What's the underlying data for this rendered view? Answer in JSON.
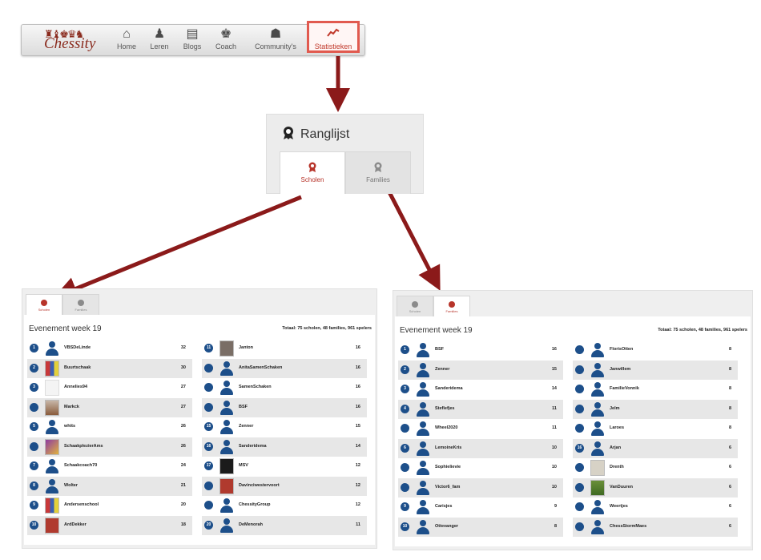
{
  "nav": {
    "logo_text": "Chessity",
    "items": [
      {
        "label": "Home",
        "icon": "home-icon"
      },
      {
        "label": "Leren",
        "icon": "pawn-icon"
      },
      {
        "label": "Blogs",
        "icon": "newspaper-icon"
      },
      {
        "label": "Coach",
        "icon": "coach-icon"
      },
      {
        "label": "Community's",
        "icon": "community-icon"
      },
      {
        "label": "Statistieken",
        "icon": "chart-line-icon"
      }
    ],
    "active_index": 5
  },
  "ranking": {
    "title": "Ranglijst",
    "tabs": [
      {
        "label": "Scholen",
        "icon": "award-icon"
      },
      {
        "label": "Families",
        "icon": "award-icon"
      }
    ]
  },
  "panel_scholen": {
    "tabs": [
      "Scholen",
      "Families"
    ],
    "active_tab": "Scholen",
    "title": "Evenement week 19",
    "total": "Totaal: 75 scholen, 48 families, 961 spelers",
    "left": [
      {
        "rank": "1",
        "name": "VBSDeLinde",
        "score": "32",
        "avatar": "generic"
      },
      {
        "rank": "2",
        "name": "Buurtschaak",
        "score": "30",
        "avatar": "multi"
      },
      {
        "rank": "3",
        "name": "Annelies94",
        "score": "27",
        "avatar": "pawn"
      },
      {
        "rank": "",
        "name": "Markck",
        "score": "27",
        "avatar": "kid"
      },
      {
        "rank": "5",
        "name": "whits",
        "score": "26",
        "avatar": "generic"
      },
      {
        "rank": "",
        "name": "SchaakplezierAms",
        "score": "26",
        "avatar": "tile"
      },
      {
        "rank": "7",
        "name": "Schaakcoach70",
        "score": "24",
        "avatar": "generic"
      },
      {
        "rank": "8",
        "name": "Wolter",
        "score": "21",
        "avatar": "generic"
      },
      {
        "rank": "9",
        "name": "Andersenschool",
        "score": "20",
        "avatar": "multi"
      },
      {
        "rank": "10",
        "name": "ArdDekker",
        "score": "18",
        "avatar": "red"
      }
    ],
    "right": [
      {
        "rank": "11",
        "name": "Janton",
        "score": "16",
        "avatar": "photo"
      },
      {
        "rank": "",
        "name": "AnitaSamenSchaken",
        "score": "16",
        "avatar": "generic"
      },
      {
        "rank": "",
        "name": "SamenSchaken",
        "score": "16",
        "avatar": "generic"
      },
      {
        "rank": "",
        "name": "BSF",
        "score": "16",
        "avatar": "generic"
      },
      {
        "rank": "15",
        "name": "Zenner",
        "score": "15",
        "avatar": "generic"
      },
      {
        "rank": "16",
        "name": "Sanderidema",
        "score": "14",
        "avatar": "generic"
      },
      {
        "rank": "17",
        "name": "MSV",
        "score": "12",
        "avatar": "chess"
      },
      {
        "rank": "",
        "name": "Davinciwestervoort",
        "score": "12",
        "avatar": "red"
      },
      {
        "rank": "",
        "name": "ChessityGroup",
        "score": "12",
        "avatar": "generic"
      },
      {
        "rank": "20",
        "name": "DeMenorah",
        "score": "11",
        "avatar": "generic"
      }
    ]
  },
  "panel_families": {
    "tabs": [
      "Scholen",
      "Families"
    ],
    "active_tab": "Families",
    "title": "Evenement week 19",
    "total": "Totaal: 75 scholen, 48 families, 961 spelers",
    "left": [
      {
        "rank": "1",
        "name": "BSF",
        "score": "16",
        "avatar": "generic"
      },
      {
        "rank": "2",
        "name": "Zenner",
        "score": "15",
        "avatar": "generic"
      },
      {
        "rank": "3",
        "name": "Sanderidema",
        "score": "14",
        "avatar": "generic"
      },
      {
        "rank": "4",
        "name": "Steflefjes",
        "score": "11",
        "avatar": "generic"
      },
      {
        "rank": "",
        "name": "Wheel2020",
        "score": "11",
        "avatar": "generic"
      },
      {
        "rank": "6",
        "name": "LemoineKris",
        "score": "10",
        "avatar": "generic"
      },
      {
        "rank": "",
        "name": "Sophielievie",
        "score": "10",
        "avatar": "generic"
      },
      {
        "rank": "",
        "name": "Victor6_fam",
        "score": "10",
        "avatar": "generic"
      },
      {
        "rank": "9",
        "name": "Carisjes",
        "score": "9",
        "avatar": "generic"
      },
      {
        "rank": "10",
        "name": "Ottevanger",
        "score": "8",
        "avatar": "generic"
      }
    ],
    "right": [
      {
        "rank": "",
        "name": "FlorisOtten",
        "score": "8",
        "avatar": "generic"
      },
      {
        "rank": "",
        "name": "Janwillem",
        "score": "8",
        "avatar": "generic"
      },
      {
        "rank": "",
        "name": "FamilieVonnik",
        "score": "8",
        "avatar": "generic"
      },
      {
        "rank": "",
        "name": "Jelm",
        "score": "8",
        "avatar": "generic"
      },
      {
        "rank": "",
        "name": "Laroes",
        "score": "8",
        "avatar": "generic"
      },
      {
        "rank": "16",
        "name": "Arjan",
        "score": "6",
        "avatar": "generic"
      },
      {
        "rank": "",
        "name": "Drenth",
        "score": "6",
        "avatar": "mole"
      },
      {
        "rank": "",
        "name": "VanDuuren",
        "score": "6",
        "avatar": "green"
      },
      {
        "rank": "",
        "name": "Weertjes",
        "score": "6",
        "avatar": "generic"
      },
      {
        "rank": "",
        "name": "ChessStormMaes",
        "score": "6",
        "avatar": "generic"
      }
    ]
  },
  "colors": {
    "accent": "#c0392b",
    "rank_badge": "#1d4f8a",
    "arrow": "#8b1a1a"
  }
}
